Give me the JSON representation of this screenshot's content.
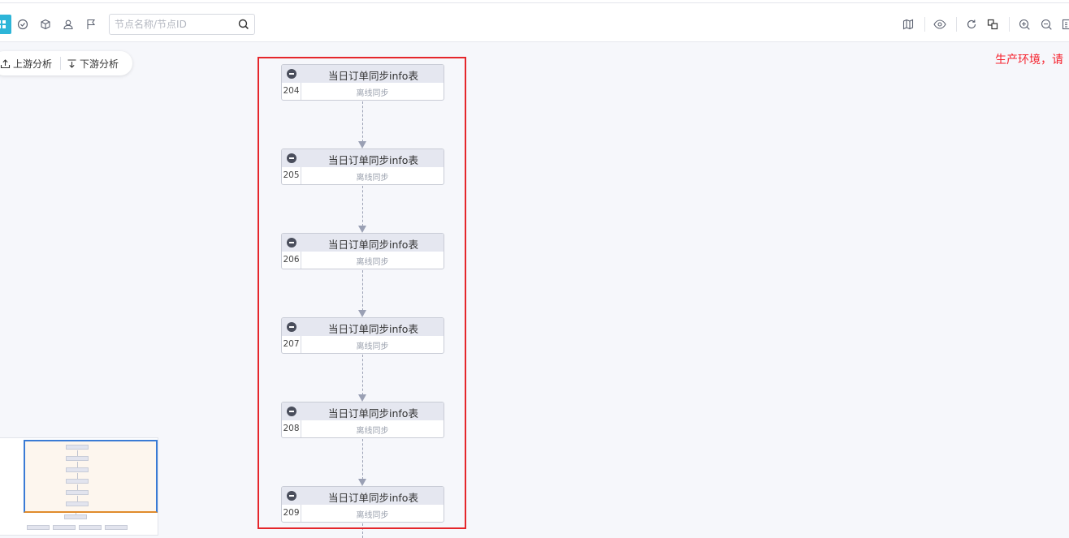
{
  "search": {
    "placeholder": "节点名称/节点ID"
  },
  "analysis": {
    "upstream_label": "上游分析",
    "downstream_label": "下游分析"
  },
  "environment_warning": "生产环境，请",
  "nodes": [
    {
      "title": "当日订单同步info表",
      "id": "204",
      "status": "离线同步"
    },
    {
      "title": "当日订单同步info表",
      "id": "205",
      "status": "离线同步"
    },
    {
      "title": "当日订单同步info表",
      "id": "206",
      "status": "离线同步"
    },
    {
      "title": "当日订单同步info表",
      "id": "207",
      "status": "离线同步"
    },
    {
      "title": "当日订单同步info表",
      "id": "208",
      "status": "离线同步"
    },
    {
      "title": "当日订单同步info表",
      "id": "209",
      "status": "离线同步"
    }
  ],
  "colors": {
    "accent": "#2db5d8",
    "highlight": "#e5262b",
    "warning": "#f5222d"
  },
  "icons": {
    "left_toolbar": [
      "grid-icon",
      "check-circle-icon",
      "cube-icon",
      "user-icon",
      "flag-icon"
    ],
    "right_toolbar": [
      "map-icon",
      "eye-icon",
      "refresh-icon",
      "layers-icon",
      "zoom-in-icon",
      "zoom-out-icon",
      "fit-icon"
    ]
  }
}
